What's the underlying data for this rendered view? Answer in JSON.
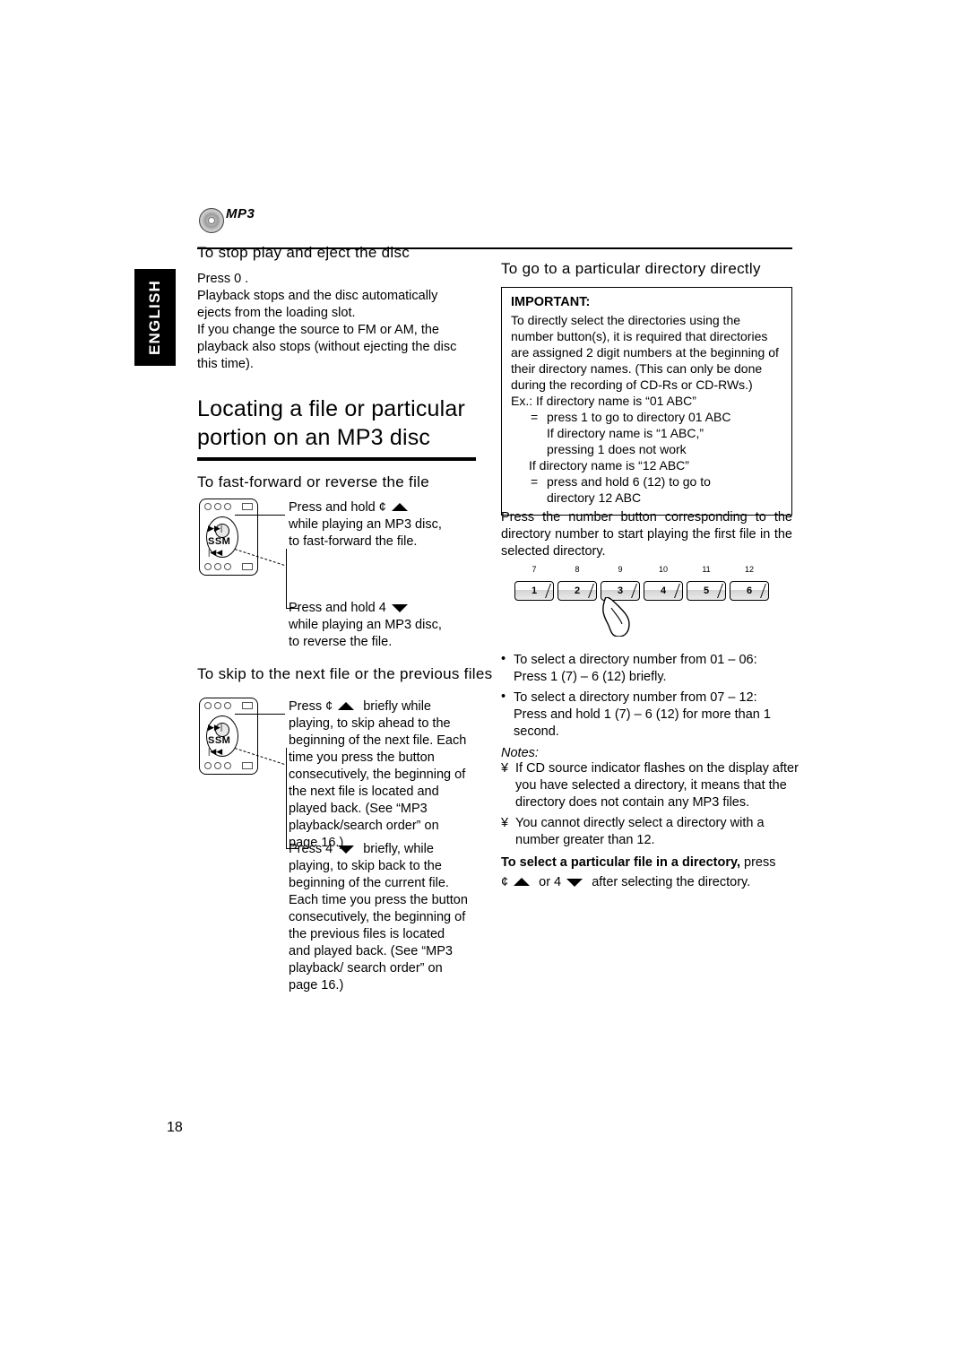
{
  "page": {
    "number": "18",
    "language_tab": "ENGLISH",
    "logo_text": "MP3"
  },
  "left": {
    "section1_title": "To stop play and eject the disc",
    "section1_p1": "Press 0 .",
    "section1_p2": "Playback stops and the disc automatically ejects from the loading slot.",
    "section1_p3": "If you change the source to FM or AM, the playback also stops (without ejecting the disc this time).",
    "big_heading_line1": "Locating a file or particular",
    "big_heading_line2": "portion on an MP3 disc",
    "section2_title": "To fast-forward or reverse the file",
    "ff_caption_line1": "Press and hold ¢",
    "ff_caption_line2": "while playing an MP3 disc,",
    "ff_caption_line3": "to fast-forward the file.",
    "rev_caption_line1": "Press and hold 4",
    "rev_caption_line2": "while playing an MP3 disc,",
    "rev_caption_line3": "to reverse the file.",
    "section3_title": "To skip to the next file or the previous files",
    "skip_next_lead": "Press ¢",
    "skip_next_text": "briefly while playing, to skip ahead to the beginning of the next file. Each time you press the button consecutively, the beginning of the next file is located and played back. (See “MP3 playback/search order” on page 16.)",
    "skip_prev_lead": "Press 4",
    "skip_prev_text": "briefly, while playing, to skip back to the beginning of the current file. Each time you press the button consecutively, the beginning of the previous files is located and played back. (See “MP3 playback/ search order” on page 16.)",
    "panel_label_ssm": "SSM"
  },
  "right": {
    "section_title": "To go to a particular directory directly",
    "important_title": "IMPORTANT:",
    "important_p1": "To directly select the directories using the number button(s), it is required that directories are assigned 2 digit numbers at the beginning of their directory names. (This can only be done during the recording of CD-Rs or CD-RWs.)",
    "important_ex1": "Ex.: If directory name is “01 ABC”",
    "important_ex1_item": "press 1 to go to directory 01 ABC",
    "important_ex1_cont1": "If directory name is “1 ABC,”",
    "important_ex1_cont2": "pressing 1 does not work",
    "important_ex2": "If directory name is “12 ABC”",
    "important_ex2_item": "press and hold 6 (12) to go to",
    "important_ex2_item2": "directory 12 ABC",
    "paragraph": "Press the number button corresponding to the directory number to start playing the first file in the selected directory.",
    "numbers": [
      {
        "top": "7",
        "main": "1"
      },
      {
        "top": "8",
        "main": "2"
      },
      {
        "top": "9",
        "main": "3"
      },
      {
        "top": "10",
        "main": "4"
      },
      {
        "top": "11",
        "main": "5"
      },
      {
        "top": "12",
        "main": "6"
      }
    ],
    "bullet1_line1": "To select a directory number from 01 – 06:",
    "bullet1_line2": "Press 1 (7) – 6 (12) briefly.",
    "bullet2_line1": "To select a directory number from 07 – 12:",
    "bullet2_line2": "Press and hold 1 (7) – 6 (12) for more than 1 second.",
    "notes_title": "Notes:",
    "note1": "If CD source indicator flashes on the display after you have selected a directory, it means that the directory does not contain any MP3 files.",
    "note2": "You cannot directly select a directory with a number greater than 12.",
    "last_bold": "To select a particular file in a directory,",
    "last_rest": " press",
    "last_line2_a": "¢",
    "last_line2_or": "or 4",
    "last_line2_b": "after selecting the directory."
  }
}
